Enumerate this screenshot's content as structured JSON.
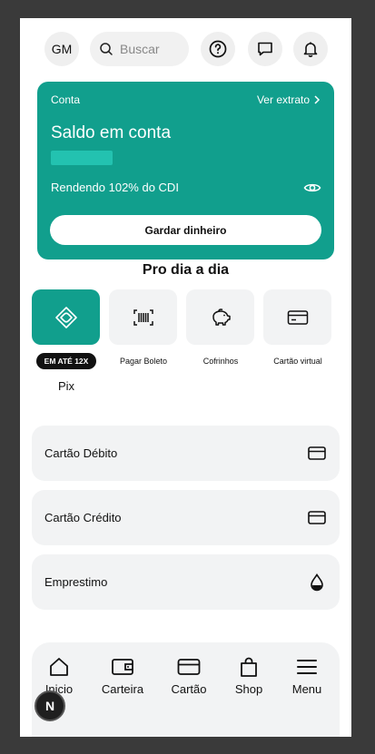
{
  "header": {
    "avatar_initials": "GM",
    "search_placeholder": "Buscar",
    "icons": [
      "help-icon",
      "chat-icon",
      "bell-icon"
    ]
  },
  "account_card": {
    "label": "Conta",
    "statement_link": "Ver extrato",
    "title": "Saldo em conta",
    "yield_text": "Rendendo 102% do CDI",
    "save_button": "Gardar dinheiro",
    "color": "#119f8d"
  },
  "section_title": "Pro dia a dia",
  "quick_actions": {
    "pix_badge": "EM ATÉ 12X",
    "pix_label": "Pix",
    "items": [
      {
        "label": "Pagar Boleto",
        "icon": "barcode-icon"
      },
      {
        "label": "Cofrinhos",
        "icon": "piggy-bank-icon"
      },
      {
        "label": "Cartão virtual",
        "icon": "credit-card-icon"
      }
    ]
  },
  "list": [
    {
      "label": "Cartão Débito",
      "icon": "credit-card-icon"
    },
    {
      "label": "Cartão Crédito",
      "icon": "credit-card-icon"
    },
    {
      "label": "Emprestimo",
      "icon": "drop-icon"
    }
  ],
  "nav": [
    {
      "label": "Inicio",
      "icon": "home-icon"
    },
    {
      "label": "Carteira",
      "icon": "wallet-icon"
    },
    {
      "label": "Cartão",
      "icon": "credit-card-icon"
    },
    {
      "label": "Shop",
      "icon": "shopping-bag-icon"
    },
    {
      "label": "Menu",
      "icon": "menu-icon"
    }
  ],
  "fab_label": "N"
}
